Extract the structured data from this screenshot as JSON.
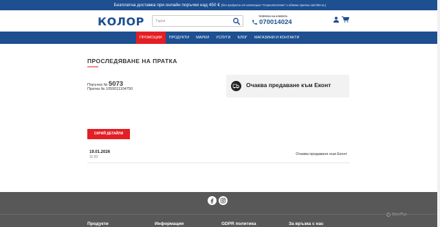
{
  "topbar": {
    "text": "Безплатна доставка при онлайн поръчки над 450 €",
    "note": "(без продукти от категория \"Строителство\" и обемни пратки над 800 кг.)"
  },
  "header": {
    "logo_text": "КОЛОР",
    "search_placeholder": "Търси",
    "phone_caption": "ТЕЛЕФОН НА КЛИЕНТА",
    "phone_number": "070014024"
  },
  "nav": {
    "items": [
      {
        "label": "Промоции"
      },
      {
        "label": "Продукти"
      },
      {
        "label": "Марки"
      },
      {
        "label": "Услуги"
      },
      {
        "label": "Блог"
      },
      {
        "label": "Магазини и контакти"
      }
    ]
  },
  "colors": {
    "brand_blue": "#1d4f91",
    "accent_red": "#e31e24",
    "footer_grey": "#585858"
  },
  "tracking": {
    "title": "ПРОСЛЕДЯВАНЕ НА ПРАТКА",
    "order_label": "Поръчка №",
    "order_number": "5073",
    "shipment_label": "Пратка №",
    "shipment_number": "1055011104750",
    "status": "Очаква предаване към Еконт",
    "hide_button": "Скрий детайли",
    "events": [
      {
        "date": "19.01.2026",
        "time": "11:33",
        "status": "Очаква предаване към Еконт"
      }
    ]
  },
  "footer": {
    "columns": [
      {
        "label": "Продукти"
      },
      {
        "label": "Информация"
      },
      {
        "label": "GDPR политика"
      },
      {
        "label": "За връзка с нас"
      }
    ],
    "watermark": "StorePlus"
  }
}
